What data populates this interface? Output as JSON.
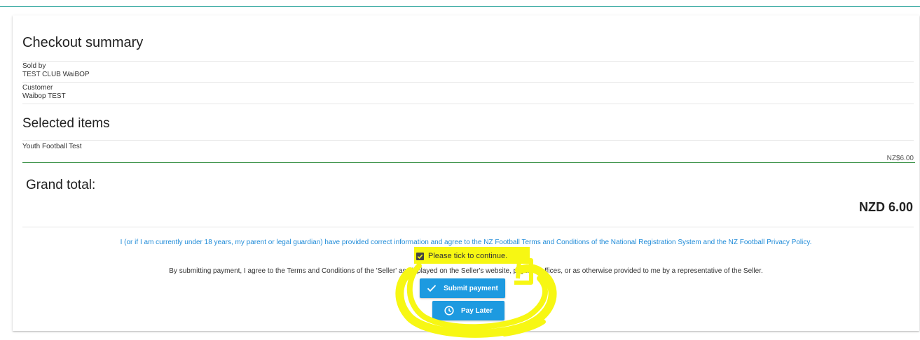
{
  "checkout": {
    "title": "Checkout summary",
    "sold_by_label": "Sold by",
    "sold_by_value": "TEST CLUB WaiBOP",
    "customer_label": "Customer",
    "customer_value": "Waibop TEST"
  },
  "items": {
    "title": "Selected items",
    "list": [
      {
        "name": "Youth Football Test",
        "price": "NZ$6.00"
      }
    ]
  },
  "grand_total": {
    "label": "Grand total:",
    "value": "NZD 6.00"
  },
  "terms": {
    "agreement_text": "I (or if I am currently under 18 years, my parent or legal guardian) have provided correct information and agree to the NZ Football Terms and Conditions of the National Registration System and the NZ Football Privacy Policy.",
    "tick_label": "Please tick to continue.",
    "tick_checked": true,
    "seller_text": "By submitting payment, I agree to the Terms and Conditions of the 'Seller' as displayed on the Seller's website, physical offices, or as otherwise provided to me by a representative of the Seller."
  },
  "actions": {
    "submit_label": "Submit payment",
    "submit_icon": "check-icon",
    "pay_later_label": "Pay Later",
    "pay_later_icon": "clock-icon"
  },
  "colors": {
    "primary_button": "#1d9ae0",
    "link_text": "#1f8bd8",
    "total_divider": "#2e8b3b",
    "highlight": "#f7f713"
  }
}
